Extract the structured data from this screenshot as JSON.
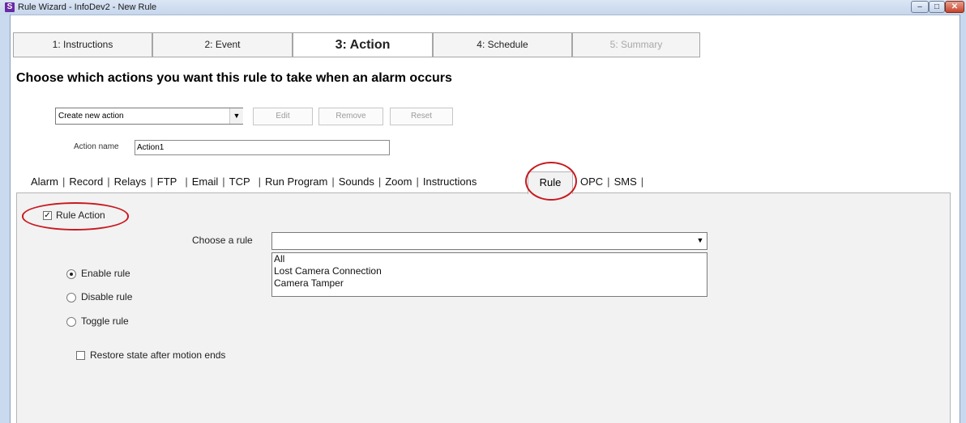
{
  "window": {
    "title": "Rule Wizard - InfoDev2 - New Rule",
    "app_icon_letter": "S"
  },
  "steps": [
    {
      "label": "1: Instructions",
      "state": "normal"
    },
    {
      "label": "2: Event",
      "state": "normal"
    },
    {
      "label": "3: Action",
      "state": "active"
    },
    {
      "label": "4: Schedule",
      "state": "normal"
    },
    {
      "label": "5: Summary",
      "state": "disabled"
    }
  ],
  "heading": "Choose which actions you want this rule to take when an alarm occurs",
  "action_select": {
    "value": "Create new action"
  },
  "buttons": {
    "edit": "Edit",
    "remove": "Remove",
    "reset": "Reset"
  },
  "action_name": {
    "label": "Action name",
    "value": "Action1"
  },
  "tabs": [
    "Alarm",
    "Record",
    "Relays",
    "FTP",
    "Email",
    "TCP",
    "Run Program",
    "Sounds",
    "Zoom",
    "Instructions",
    "Rule",
    "OPC",
    "SMS"
  ],
  "active_tab": "Rule",
  "rule_panel": {
    "rule_action_label": "Rule Action",
    "rule_action_checked": true,
    "choose_rule_label": "Choose a rule",
    "choose_rule_value": "",
    "rule_options": [
      "All",
      "Lost Camera Connection",
      "Camera Tamper"
    ],
    "radio_options": [
      {
        "label": "Enable rule",
        "selected": true
      },
      {
        "label": "Disable rule",
        "selected": false
      },
      {
        "label": "Toggle rule",
        "selected": false
      }
    ],
    "restore_label": "Restore state after motion ends",
    "restore_checked": false
  },
  "colors": {
    "highlight_circle": "#c8191f",
    "panel_bg": "#f2f2f2"
  }
}
